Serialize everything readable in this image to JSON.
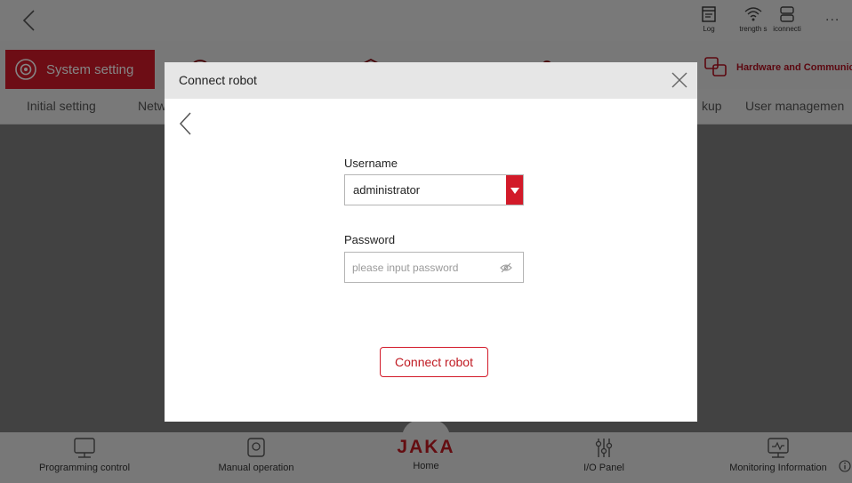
{
  "topbar": {
    "log_label": "Log",
    "signal_label": "trength s",
    "connect_label": "iconnecti",
    "more_label": "..."
  },
  "module_tabs": {
    "active_label": "System setting",
    "hardware_label": "Hardware and Communicatio"
  },
  "sub_tabs": {
    "initial": "Initial setting",
    "network": "Netw",
    "backup": "kup",
    "user_management": "User managemen"
  },
  "modal": {
    "title": "Connect robot",
    "username_label": "Username",
    "username_value": "administrator",
    "password_label": "Password",
    "password_placeholder": "please input password",
    "connect_button": "Connect robot"
  },
  "bottom_nav": {
    "programming": "Programming control",
    "manual": "Manual operation",
    "brand": "JAKA",
    "home": "Home",
    "io": "I/O Panel",
    "monitoring": "Monitoring Information"
  },
  "colors": {
    "accent": "#d21a29",
    "brand": "#c01a22"
  }
}
